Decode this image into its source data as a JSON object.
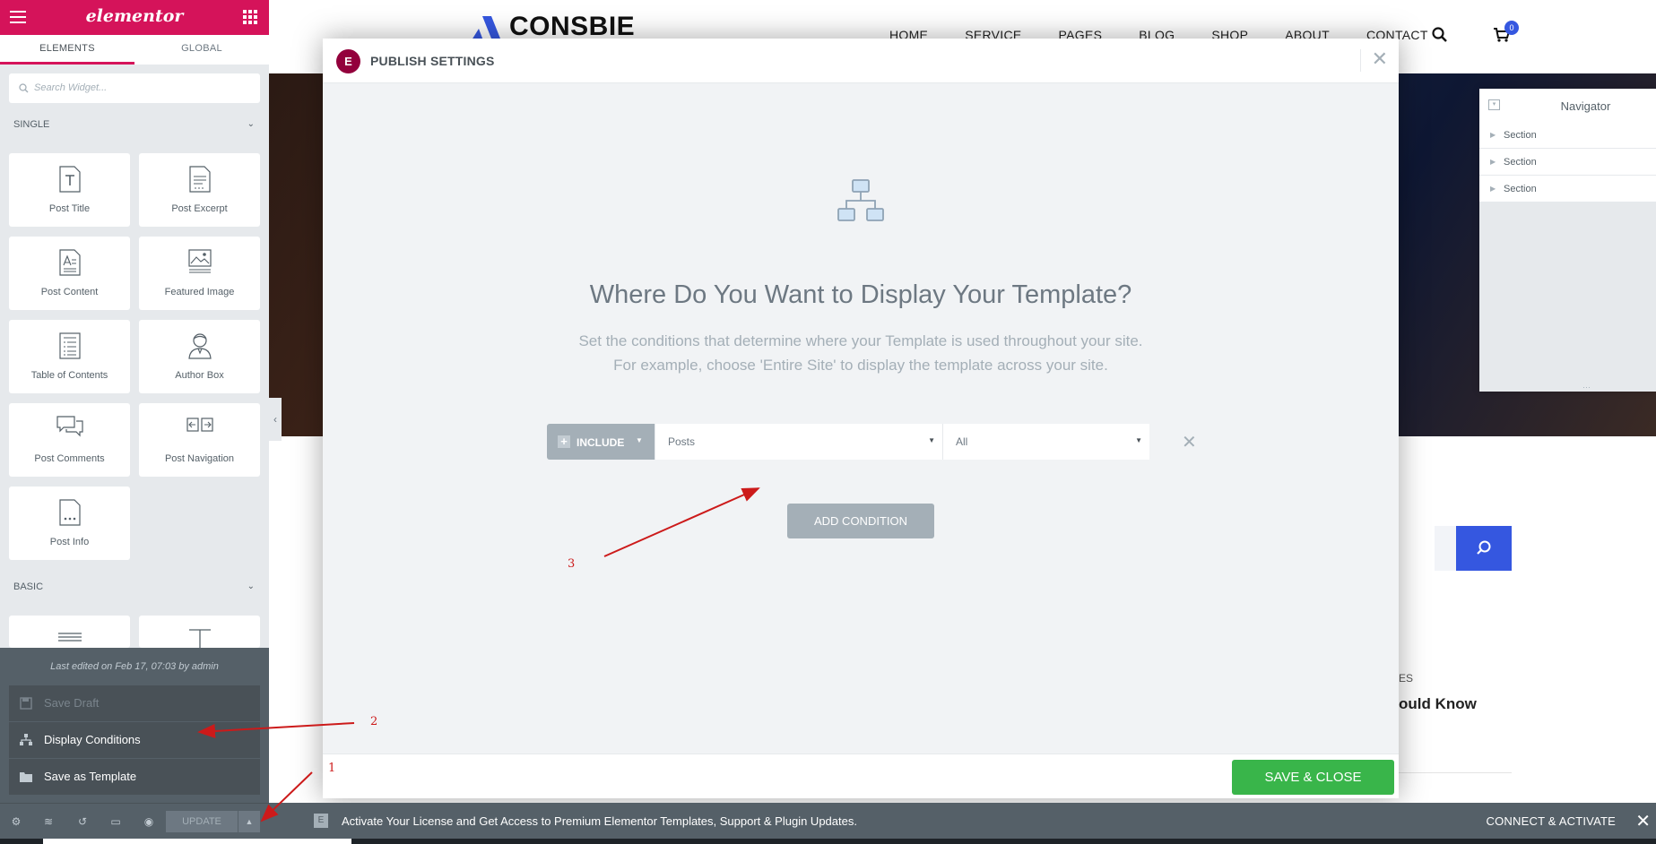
{
  "panel": {
    "brand": "elementor",
    "tabs": [
      "ELEMENTS",
      "GLOBAL"
    ],
    "search_placeholder": "Search Widget...",
    "category_single": "SINGLE",
    "category_basic": "BASIC",
    "widgets": [
      "Post Title",
      "Post Excerpt",
      "Post Content",
      "Featured Image",
      "Table of Contents",
      "Author Box",
      "Post Comments",
      "Post Navigation",
      "Post Info"
    ],
    "last_edited": "Last edited on Feb 17, 07:03 by admin",
    "save_draft": "Save Draft",
    "display_conditions": "Display Conditions",
    "save_as_template": "Save as Template",
    "update_label": "UPDATE"
  },
  "site": {
    "logo_text": "CONSBIE",
    "nav": [
      "HOME",
      "SERVICE",
      "PAGES",
      "BLOG",
      "SHOP",
      "ABOUT",
      "CONTACT"
    ],
    "cart_count": "0",
    "partial_heading": "ould Know",
    "partial_category": "ES"
  },
  "navigator": {
    "title": "Navigator",
    "items": [
      "Section",
      "Section",
      "Section"
    ]
  },
  "modal": {
    "logo": "E",
    "title": "PUBLISH SETTINGS",
    "heading": "Where Do You Want to Display Your Template?",
    "subtitle_line1": "Set the conditions that determine where your Template is used throughout your site.",
    "subtitle_line2": "For example, choose 'Entire Site' to display the template across your site.",
    "include_label": "INCLUDE",
    "select_type": "Posts",
    "select_scope": "All",
    "add_condition": "ADD CONDITION",
    "save_close": "SAVE & CLOSE"
  },
  "license_bar": {
    "message": "Activate Your License and Get Access to Premium Elementor Templates, Support & Plugin Updates.",
    "action": "CONNECT & ACTIVATE"
  },
  "annotations": [
    "1",
    "2",
    "3"
  ],
  "colors": {
    "brand": "#d5135a",
    "modal_logo": "#93003c",
    "save_green": "#39b54a",
    "accent_blue": "#3557e0",
    "annotation_red": "#cc1a1a"
  }
}
